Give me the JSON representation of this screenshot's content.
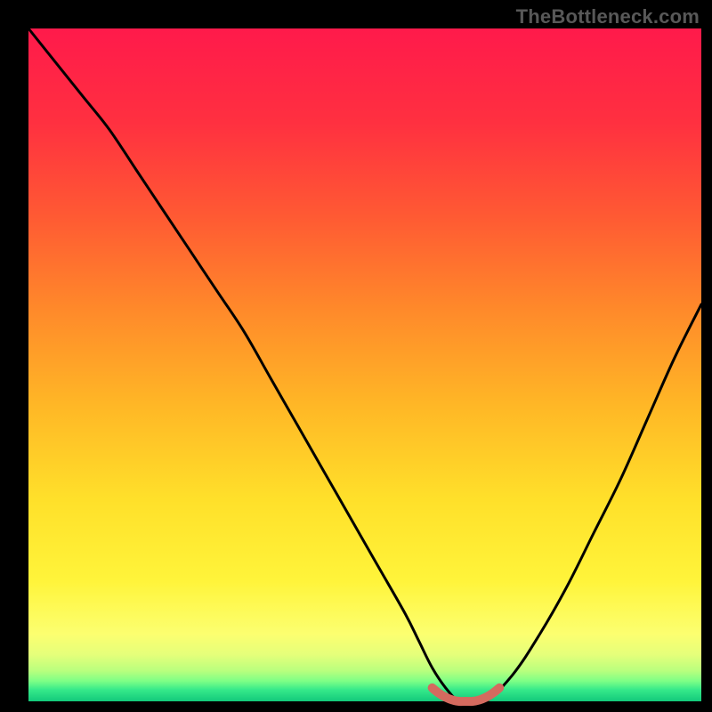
{
  "watermark": "TheBottleneck.com",
  "colors": {
    "frame": "#000000",
    "curve": "#000000",
    "marker": "#d46a5f"
  },
  "gradient_stops": [
    {
      "pct": 0,
      "color": "#ff1a4b"
    },
    {
      "pct": 14,
      "color": "#ff3040"
    },
    {
      "pct": 28,
      "color": "#ff5a33"
    },
    {
      "pct": 42,
      "color": "#ff8a2a"
    },
    {
      "pct": 56,
      "color": "#ffb726"
    },
    {
      "pct": 70,
      "color": "#ffe02a"
    },
    {
      "pct": 82,
      "color": "#fff43a"
    },
    {
      "pct": 90,
      "color": "#fcff70"
    },
    {
      "pct": 93,
      "color": "#e6ff7a"
    },
    {
      "pct": 95.5,
      "color": "#b8ff7e"
    },
    {
      "pct": 97,
      "color": "#7dff86"
    },
    {
      "pct": 98.3,
      "color": "#35e98a"
    },
    {
      "pct": 100,
      "color": "#13c97b"
    }
  ],
  "chart_data": {
    "type": "line",
    "title": "",
    "xlabel": "",
    "ylabel": "",
    "xlim": [
      0,
      100
    ],
    "ylim": [
      0,
      100
    ],
    "grid": false,
    "legend": false,
    "series": [
      {
        "name": "bottleneck-curve",
        "x": [
          0,
          4,
          8,
          12,
          16,
          20,
          24,
          28,
          32,
          36,
          40,
          44,
          48,
          52,
          56,
          58,
          60,
          62,
          64,
          66,
          68,
          72,
          76,
          80,
          84,
          88,
          92,
          96,
          100
        ],
        "y": [
          100,
          95,
          90,
          85,
          79,
          73,
          67,
          61,
          55,
          48,
          41,
          34,
          27,
          20,
          13,
          9,
          5,
          2,
          0,
          0,
          0,
          4,
          10,
          17,
          25,
          33,
          42,
          51,
          59
        ]
      },
      {
        "name": "optimal-range-marker",
        "x": [
          60,
          61,
          62,
          63,
          64,
          65,
          66,
          67,
          68,
          69,
          70
        ],
        "y": [
          2,
          1.2,
          0.6,
          0.2,
          0,
          0,
          0,
          0.2,
          0.6,
          1.2,
          2
        ]
      }
    ]
  }
}
